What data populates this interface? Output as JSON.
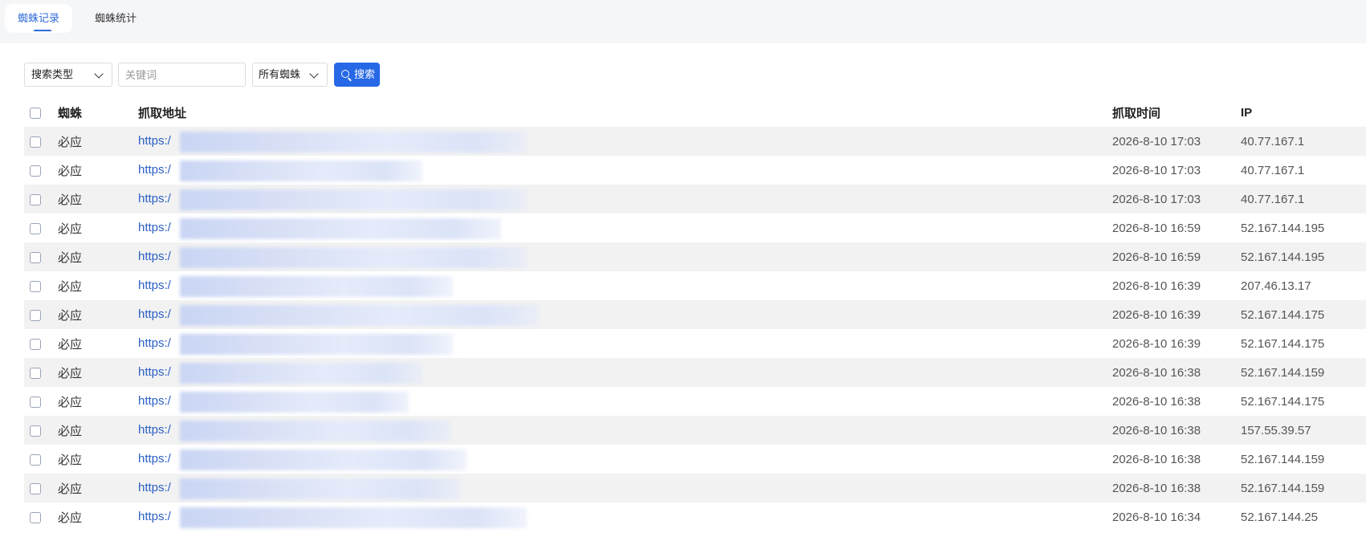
{
  "tabs": [
    {
      "label": "蜘蛛记录",
      "active": true
    },
    {
      "label": "蜘蛛统计",
      "active": false
    }
  ],
  "toolbar": {
    "search_type": "搜索类型",
    "keyword_placeholder": "关键词",
    "spider_filter": "所有蜘蛛",
    "search_button": "搜索"
  },
  "table": {
    "headers": {
      "spider": "蜘蛛",
      "url": "抓取地址",
      "time": "抓取时间",
      "ip": "IP"
    },
    "rows": [
      {
        "spider": "必应",
        "url": "https:/",
        "time": "2026-8-10 17:03",
        "ip": "40.77.167.1"
      },
      {
        "spider": "必应",
        "url": "https:/",
        "time": "2026-8-10 17:03",
        "ip": "40.77.167.1"
      },
      {
        "spider": "必应",
        "url": "https:/",
        "time": "2026-8-10 17:03",
        "ip": "40.77.167.1"
      },
      {
        "spider": "必应",
        "url": "https:/",
        "time": "2026-8-10 16:59",
        "ip": "52.167.144.195"
      },
      {
        "spider": "必应",
        "url": "https:/",
        "time": "2026-8-10 16:59",
        "ip": "52.167.144.195"
      },
      {
        "spider": "必应",
        "url": "https:/",
        "time": "2026-8-10 16:39",
        "ip": "207.46.13.17"
      },
      {
        "spider": "必应",
        "url": "https:/",
        "time": "2026-8-10 16:39",
        "ip": "52.167.144.175"
      },
      {
        "spider": "必应",
        "url": "https:/",
        "time": "2026-8-10 16:39",
        "ip": "52.167.144.175"
      },
      {
        "spider": "必应",
        "url": "https:/",
        "time": "2026-8-10 16:38",
        "ip": "52.167.144.159"
      },
      {
        "spider": "必应",
        "url": "https:/",
        "time": "2026-8-10 16:38",
        "ip": "52.167.144.175"
      },
      {
        "spider": "必应",
        "url": "https:/",
        "time": "2026-8-10 16:38",
        "ip": "157.55.39.57"
      },
      {
        "spider": "必应",
        "url": "https:/",
        "time": "2026-8-10 16:38",
        "ip": "52.167.144.159"
      },
      {
        "spider": "必应",
        "url": "https:/",
        "time": "2026-8-10 16:38",
        "ip": "52.167.144.159"
      },
      {
        "spider": "必应",
        "url": "https:/",
        "time": "2026-8-10 16:34",
        "ip": "52.167.144.25"
      }
    ]
  },
  "colors": {
    "accent": "#2668e6",
    "link": "#2a5fc4",
    "stripe": "#f2f2f2"
  }
}
